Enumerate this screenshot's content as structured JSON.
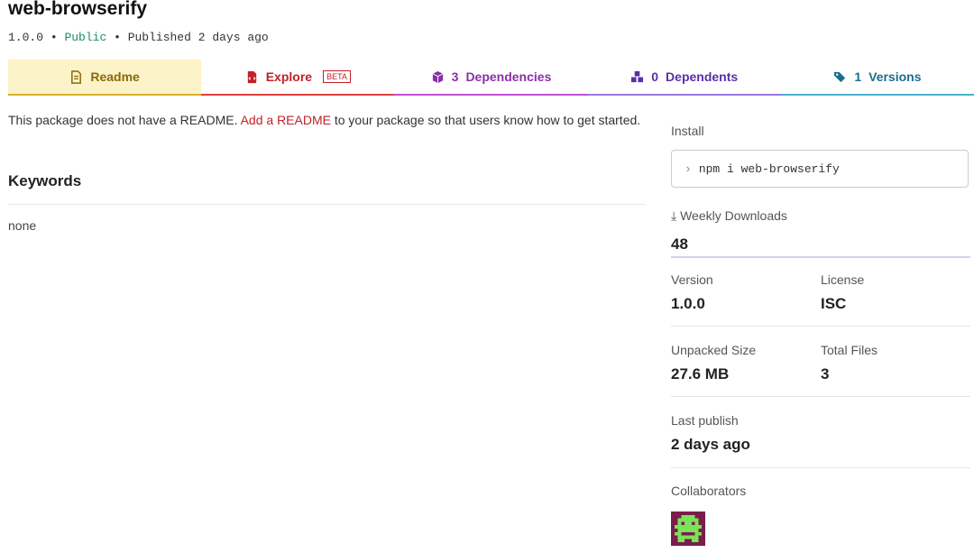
{
  "package": {
    "name": "web-browserify",
    "version": "1.0.0",
    "separator": "•",
    "visibility": "Public",
    "published": "Published 2 days ago"
  },
  "tabs": {
    "readme": {
      "label": "Readme",
      "icon": "file-text-icon"
    },
    "explore": {
      "label": "Explore",
      "badge": "BETA",
      "icon": "file-code-icon"
    },
    "dependencies": {
      "count": "3",
      "label": "Dependencies",
      "icon": "box-icon"
    },
    "dependents": {
      "count": "0",
      "label": "Dependents",
      "icon": "boxes-icon"
    },
    "versions": {
      "count": "1",
      "label": "Versions",
      "icon": "tags-icon"
    }
  },
  "readme": {
    "prefix": "This package does not have a README.",
    "link": "Add a README",
    "suffix": "to your package so that users know how to get started."
  },
  "keywords": {
    "title": "Keywords",
    "value": "none"
  },
  "sidebar": {
    "install_label": "Install",
    "install_command": "npm i web-browserify",
    "weekly_downloads_label": "Weekly Downloads",
    "weekly_downloads": "48",
    "version_label": "Version",
    "version": "1.0.0",
    "license_label": "License",
    "license": "ISC",
    "unpacked_size_label": "Unpacked Size",
    "unpacked_size": "27.6 MB",
    "total_files_label": "Total Files",
    "total_files": "3",
    "last_publish_label": "Last publish",
    "last_publish": "2 days ago",
    "collaborators_label": "Collaborators"
  },
  "colors": {
    "readme_tab": "#d9b22b",
    "explore_tab": "#c12127",
    "dependencies_tab": "#8b2fa8",
    "dependents_tab": "#5b2fa8",
    "versions_tab": "#1b6e8c",
    "public": "#1f8a70"
  }
}
